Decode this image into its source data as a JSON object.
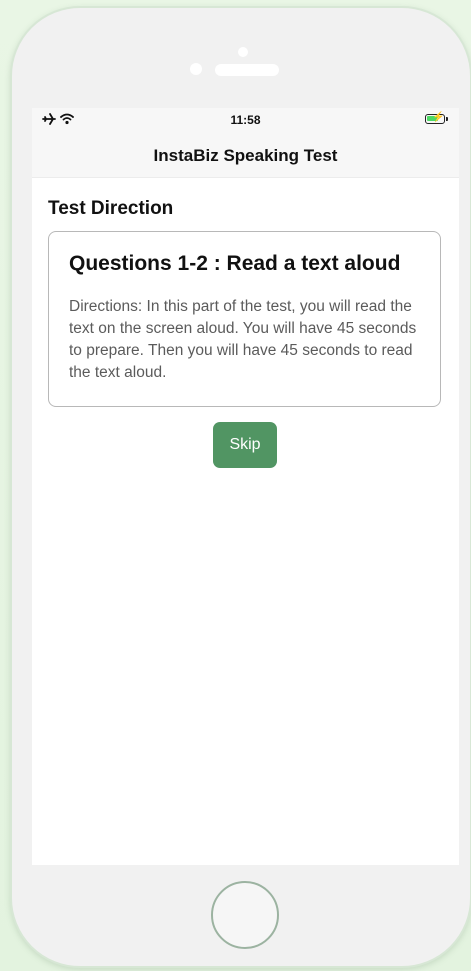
{
  "status_bar": {
    "time": "11:58",
    "airplane_icon": "airplane-icon",
    "wifi_icon": "wifi-icon",
    "battery_icon": "battery-charging-icon",
    "battery_level": 0.8
  },
  "nav": {
    "title": "InstaBiz Speaking Test"
  },
  "section": {
    "title": "Test Direction"
  },
  "card": {
    "title": "Questions 1-2 : Read a text aloud",
    "body": "Directions: In this part of the test, you will read the text on the screen aloud. You will have 45 seconds to prepare. Then you will have 45 seconds to read the text aloud."
  },
  "skip_button": {
    "label": "Skip"
  },
  "colors": {
    "accent": "#519563",
    "background": "#e6f5e1",
    "phone_frame": "#f1f1f1"
  }
}
